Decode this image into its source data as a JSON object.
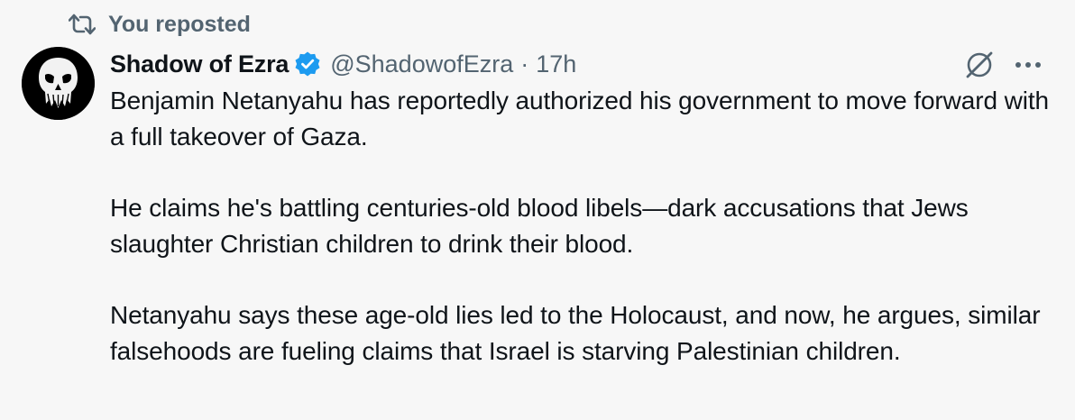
{
  "repost": {
    "label": "You reposted",
    "icon": "repost-icon"
  },
  "author": {
    "display_name": "Shadow of Ezra",
    "handle": "@ShadowofEzra",
    "separator": "·",
    "time": "17h",
    "verified": true,
    "verified_color": "#1d9bf0",
    "avatar_icon": "punisher-skull-avatar"
  },
  "actions": {
    "grok_icon": "grok-icon",
    "more_icon": "more-options-icon"
  },
  "tweet": {
    "paragraphs": [
      "Benjamin Netanyahu has reportedly authorized his government to move forward with a full takeover of Gaza.",
      "He claims he's battling centuries-old blood libels—dark accusations that Jews slaughter Christian children to drink their blood.",
      "Netanyahu says these age-old lies led to the Holocaust, and now, he argues, similar falsehoods are fueling claims that Israel is starving Palestinian children."
    ]
  }
}
